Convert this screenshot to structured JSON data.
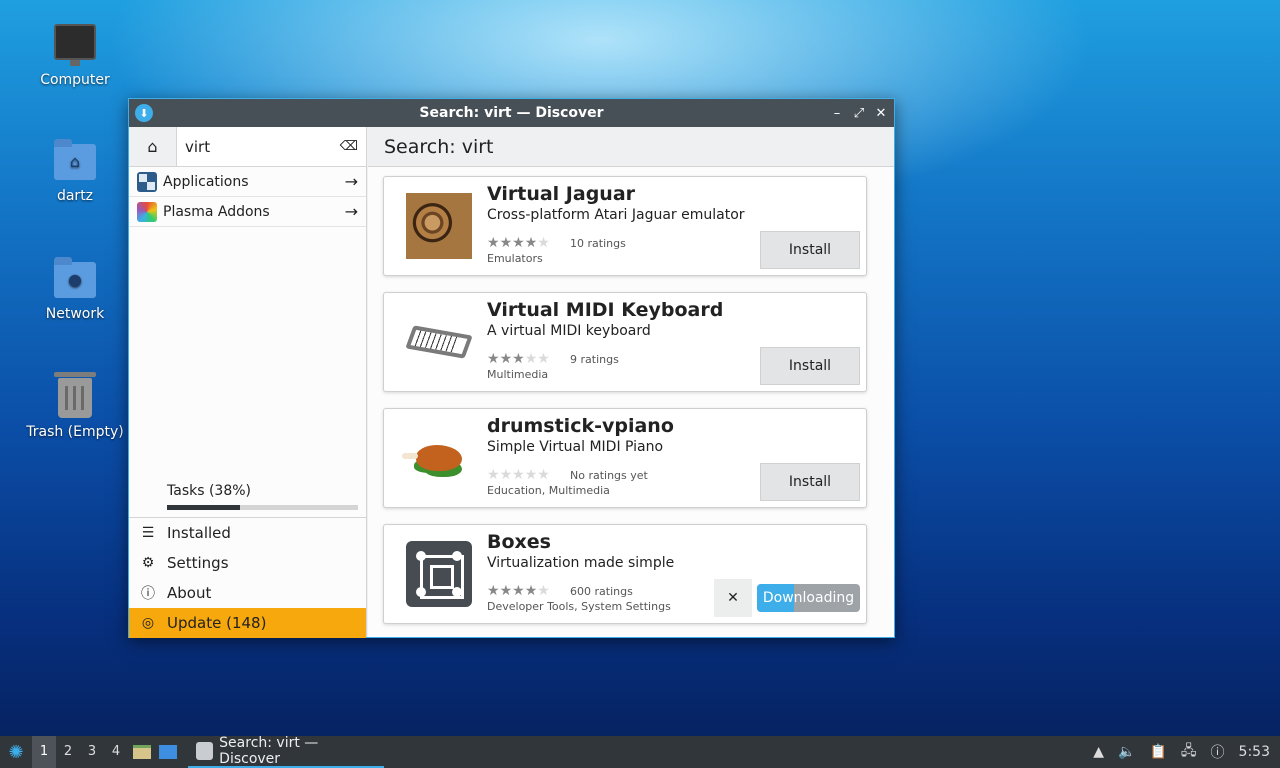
{
  "desktop": {
    "icons": [
      {
        "label": "Computer"
      },
      {
        "label": "dartz"
      },
      {
        "label": "Network"
      },
      {
        "label": "Trash (Empty)"
      }
    ]
  },
  "window": {
    "title": "Search: virt — Discover",
    "sidebar": {
      "search_value": "virt",
      "categories": [
        {
          "label": "Applications"
        },
        {
          "label": "Plasma Addons"
        }
      ],
      "tasks_label": "Tasks (38%)",
      "tasks_progress": 0.38,
      "items": [
        {
          "label": "Installed",
          "icon": "list-icon"
        },
        {
          "label": "Settings",
          "icon": "gear-icon"
        },
        {
          "label": "About",
          "icon": "info-icon"
        },
        {
          "label": "Update (148)",
          "icon": "update-icon"
        }
      ]
    },
    "main": {
      "header": "Search: virt",
      "results": [
        {
          "name": "Virtual Jaguar",
          "desc": "Cross-platform Atari Jaguar emulator",
          "stars": 4,
          "ratings": "10 ratings",
          "category": "Emulators",
          "button": "Install"
        },
        {
          "name": "Virtual MIDI Keyboard",
          "desc": "A virtual MIDI keyboard",
          "stars": 3,
          "ratings": "9 ratings",
          "category": "Multimedia",
          "button": "Install"
        },
        {
          "name": "drumstick-vpiano",
          "desc": "Simple Virtual MIDI Piano",
          "stars": 0,
          "ratings": "No ratings yet",
          "category": "Education, Multimedia",
          "button": "Install"
        },
        {
          "name": "Boxes",
          "desc": "Virtualization made simple",
          "stars": 4,
          "ratings": "600 ratings",
          "category": "Developer Tools, System Settings",
          "button": "Downloading",
          "cancel": "✕",
          "download_progress": 0.36
        }
      ]
    }
  },
  "taskbar": {
    "desktops": [
      "1",
      "2",
      "3",
      "4"
    ],
    "task_label": "Search: virt — Discover",
    "clock": "5:53"
  }
}
